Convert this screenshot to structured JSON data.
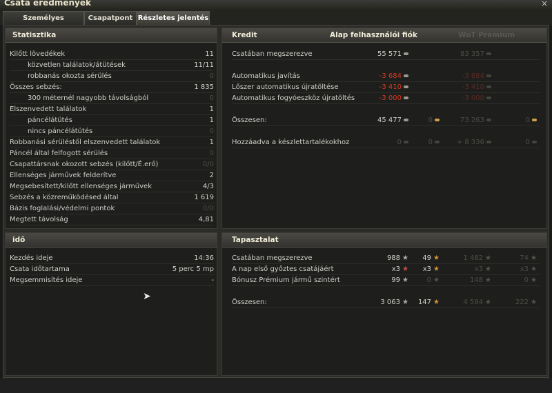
{
  "window": {
    "title": "Csata eredmények",
    "close": "×"
  },
  "tabs": [
    "Személyes eredmény",
    "Csapatpont",
    "Részletes jelentés"
  ],
  "stats": {
    "title": "Statisztika",
    "rows": [
      {
        "label": "Kilőtt lövedékek",
        "value": "11"
      },
      {
        "label": "közvetlen találatok/átütések",
        "value": "11/11"
      },
      {
        "label": "robbanás okozta sérülés",
        "value": "0"
      },
      {
        "label": "Összes sebzés:",
        "value": "1 835"
      },
      {
        "label": "300 méternél nagyobb távolságból",
        "value": "0"
      },
      {
        "label": "Elszenvedett találatok",
        "value": "1"
      },
      {
        "label": "páncélátütés",
        "value": "1"
      },
      {
        "label": "nincs páncélátütés",
        "value": "0"
      },
      {
        "label": "Robbanási sérüléstől elszenvedett találatok",
        "value": "1"
      },
      {
        "label": "Páncél által felfogott sérülés",
        "value": "0"
      },
      {
        "label": "Csapattársnak okozott sebzés (kilőtt/É.erő)",
        "value": "0/0"
      },
      {
        "label": "Ellenséges járművek felderítve",
        "value": "2"
      },
      {
        "label": "Megsebesített/kilőtt ellenséges járművek",
        "value": "4/3"
      },
      {
        "label": "Sebzés a közreműködésed által",
        "value": "1 619"
      },
      {
        "label": "Bázis foglalási/védelmi pontok",
        "value": "0/0"
      },
      {
        "label": "Megtett távolság",
        "value": "4,81"
      }
    ]
  },
  "time": {
    "title": "idő",
    "rows": [
      {
        "label": "Kezdés ideje",
        "value": "14:36"
      },
      {
        "label": "Csata időtartama",
        "value": "5 perc 5 mp"
      },
      {
        "label": "Megsemmisítés ideje",
        "value": "-"
      }
    ]
  },
  "credit": {
    "title": "Kredit",
    "col_basic": "Alap felhasználói fiók",
    "col_premium": "WoT Prémium",
    "rows": [
      {
        "label": "Csatában megszerezve",
        "a": "55 571",
        "b": "",
        "c": "83 357",
        "d": ""
      },
      {
        "label": "Automatikus javítás",
        "a": "-3 684",
        "b": "",
        "c": "-3 684",
        "d": ""
      },
      {
        "label": "Lőszer automatikus újratöltése",
        "a": "-3 410",
        "b": "",
        "c": "-3 410",
        "d": ""
      },
      {
        "label": "Automatikus fogyóeszköz újratöltés",
        "a": "-3 000",
        "b": "",
        "c": "-3 000",
        "d": ""
      },
      {
        "label": "Összesen:",
        "a": "45 477",
        "b": "0",
        "c": "73 263",
        "d": "0"
      },
      {
        "label": "Hozzáadva a készlettartalékokhoz",
        "a": "0",
        "b": "0",
        "c": "+ 8 336",
        "d": "0"
      }
    ]
  },
  "xp": {
    "title": "Tapasztalat",
    "rows": [
      {
        "label": "Csatában megszerezve",
        "a": "988",
        "b": "49",
        "c": "1 482",
        "d": "74"
      },
      {
        "label": "A nap első győztes csatájáért",
        "a": "x3",
        "b": "x3",
        "c": "x3",
        "d": "x3"
      },
      {
        "label": "Bónusz Prémium jármű szintért",
        "a": "99",
        "b": "0",
        "c": "148",
        "d": "0"
      },
      {
        "label": "Összesen:",
        "a": "3 063",
        "b": "147",
        "c": "4 594",
        "d": "222"
      }
    ]
  },
  "icons": {
    "credit": "credit-coin-icon",
    "gold": "gold-coin-icon",
    "xp": "xp-star-icon",
    "free_xp": "free-xp-star-icon"
  },
  "colors": {
    "negative": "#d83a22",
    "dim": "#4d4c47",
    "text": "#cfcfc9"
  }
}
